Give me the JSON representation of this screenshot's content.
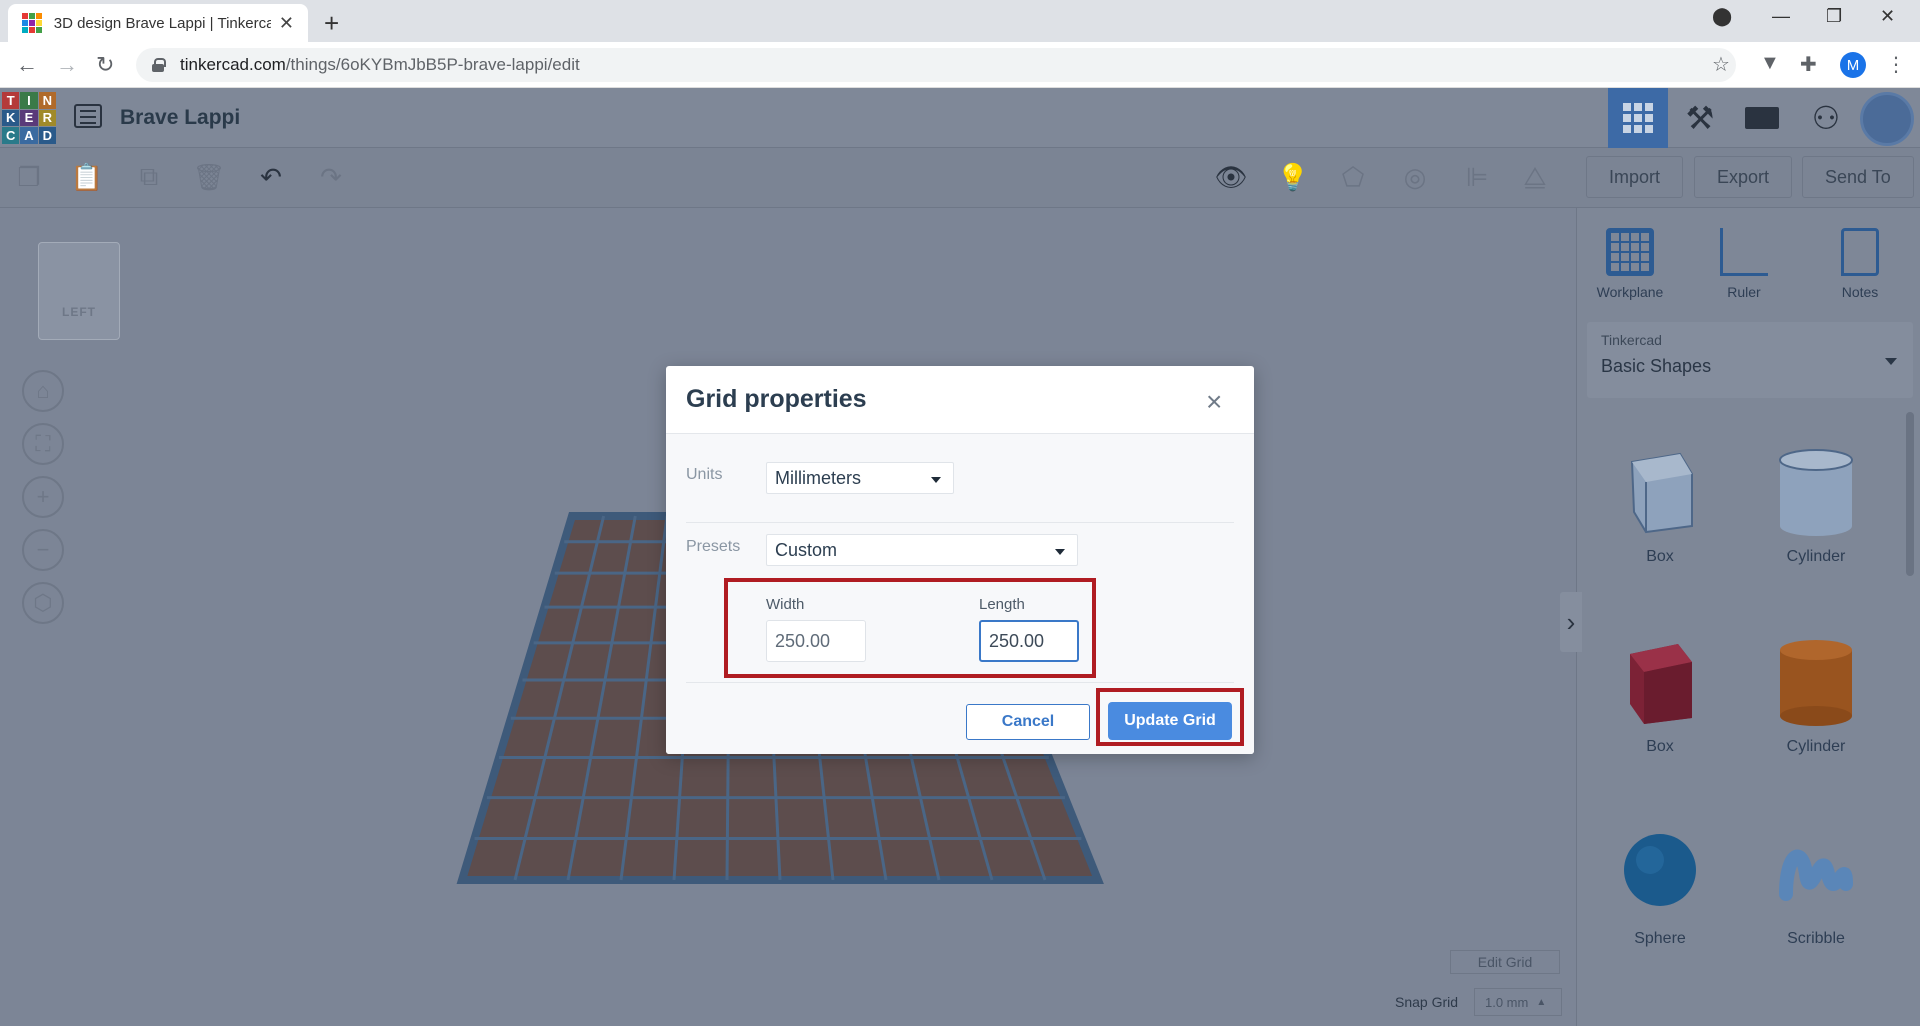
{
  "browser": {
    "tab_title": "3D design Brave Lappi | Tinkercad",
    "url_host": "tinkercad.com",
    "url_path": "/things/6oKYBmJbB5P-brave-lappi/edit",
    "profile_initial": "M"
  },
  "app": {
    "logo_letters": [
      "T",
      "I",
      "N",
      "K",
      "E",
      "R",
      "C",
      "A",
      "D"
    ],
    "project_name": "Brave Lappi",
    "accent_color": "#3a78c8"
  },
  "toolbar": {
    "import_label": "Import",
    "export_label": "Export",
    "send_to_label": "Send To"
  },
  "right_panel": {
    "workplane_label": "Workplane",
    "ruler_label": "Ruler",
    "notes_label": "Notes",
    "library_category": "Tinkercad",
    "library_name": "Basic Shapes",
    "shapes": [
      {
        "label": "Box",
        "color": "#8aa0bc",
        "kind": "box-hole"
      },
      {
        "label": "Cylinder",
        "color": "#8aa0bc",
        "kind": "cyl-hole"
      },
      {
        "label": "Box",
        "color": "#8c2a3d",
        "kind": "box"
      },
      {
        "label": "Cylinder",
        "color": "#a05a28",
        "kind": "cyl"
      },
      {
        "label": "Sphere",
        "color": "#1d5a8c",
        "kind": "sphere"
      },
      {
        "label": "Scribble",
        "color": "#5a86b8",
        "kind": "scribble"
      }
    ]
  },
  "canvas": {
    "viewcube_face": "LEFT",
    "edit_grid_label": "Edit Grid",
    "snap_grid_label": "Snap Grid",
    "snap_grid_value": "1.0 mm"
  },
  "modal": {
    "title": "Grid properties",
    "units_label": "Units",
    "units_value": "Millimeters",
    "presets_label": "Presets",
    "presets_value": "Custom",
    "width_label": "Width",
    "width_value": "250.00",
    "length_label": "Length",
    "length_value": "250.00",
    "cancel_label": "Cancel",
    "update_label": "Update Grid",
    "highlight_color": "#b01c22"
  }
}
